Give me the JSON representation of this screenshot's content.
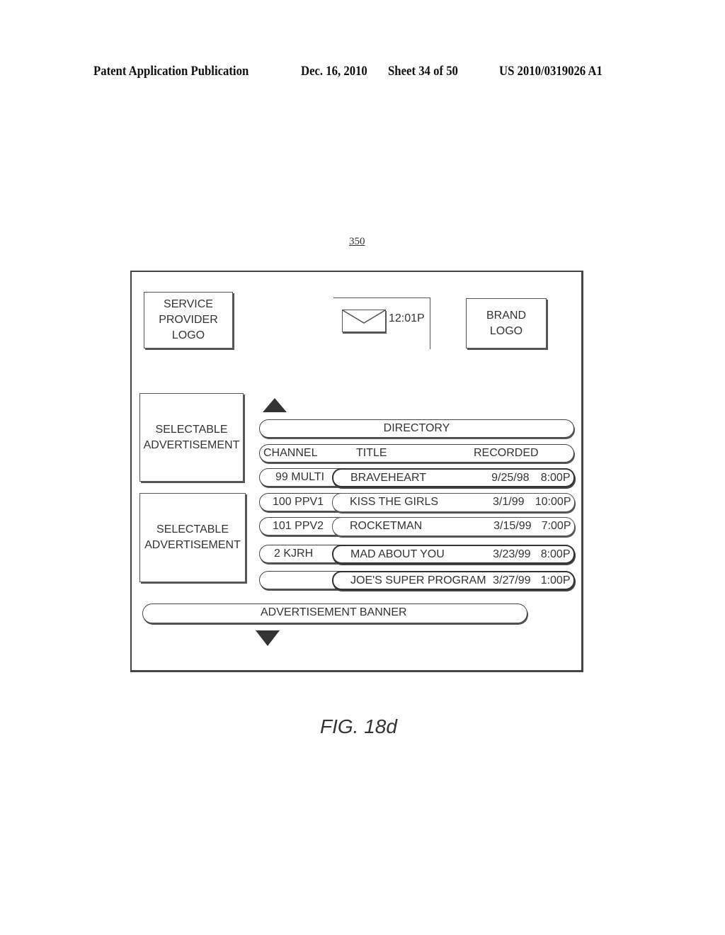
{
  "header": {
    "publication": "Patent Application Publication",
    "date": "Dec. 16, 2010",
    "sheet": "Sheet 34 of 50",
    "number": "US 2010/0319026 A1"
  },
  "reference_number": "350",
  "screen": {
    "service_provider_logo": [
      "SERVICE",
      "PROVIDER",
      "LOGO"
    ],
    "mail_icon": "envelope-icon",
    "time": "12:01P",
    "brand_logo": [
      "BRAND",
      "LOGO"
    ],
    "ads": [
      {
        "lines": [
          "SELECTABLE",
          "ADVERTISEMENT"
        ]
      },
      {
        "lines": [
          "SELECTABLE",
          "ADVERTISEMENT"
        ]
      }
    ],
    "scroll_up_icon": "triangle-up-icon",
    "scroll_down_icon": "triangle-down-icon",
    "directory_title": "DIRECTORY",
    "columns": {
      "channel": "CHANNEL",
      "title": "TITLE",
      "recorded": "RECORDED"
    },
    "rows": [
      {
        "channel": "99 MULTI",
        "title": "BRAVEHEART",
        "date": "9/25/98",
        "time": "8:00P"
      },
      {
        "channel": "100 PPV1",
        "title": "KISS THE GIRLS",
        "date": "3/1/99",
        "time": "10:00P"
      },
      {
        "channel": "101 PPV2",
        "title": "ROCKETMAN",
        "date": "3/15/99",
        "time": "7:00P"
      },
      {
        "channel": "2 KJRH",
        "title": "MAD ABOUT YOU",
        "date": "3/23/99",
        "time": "8:00P"
      },
      {
        "channel": "",
        "title": "JOE'S SUPER PROGRAM",
        "date": "3/27/99",
        "time": "1:00P"
      }
    ],
    "banner": "ADVERTISEMENT BANNER"
  },
  "figure_label": "FIG. 18d"
}
